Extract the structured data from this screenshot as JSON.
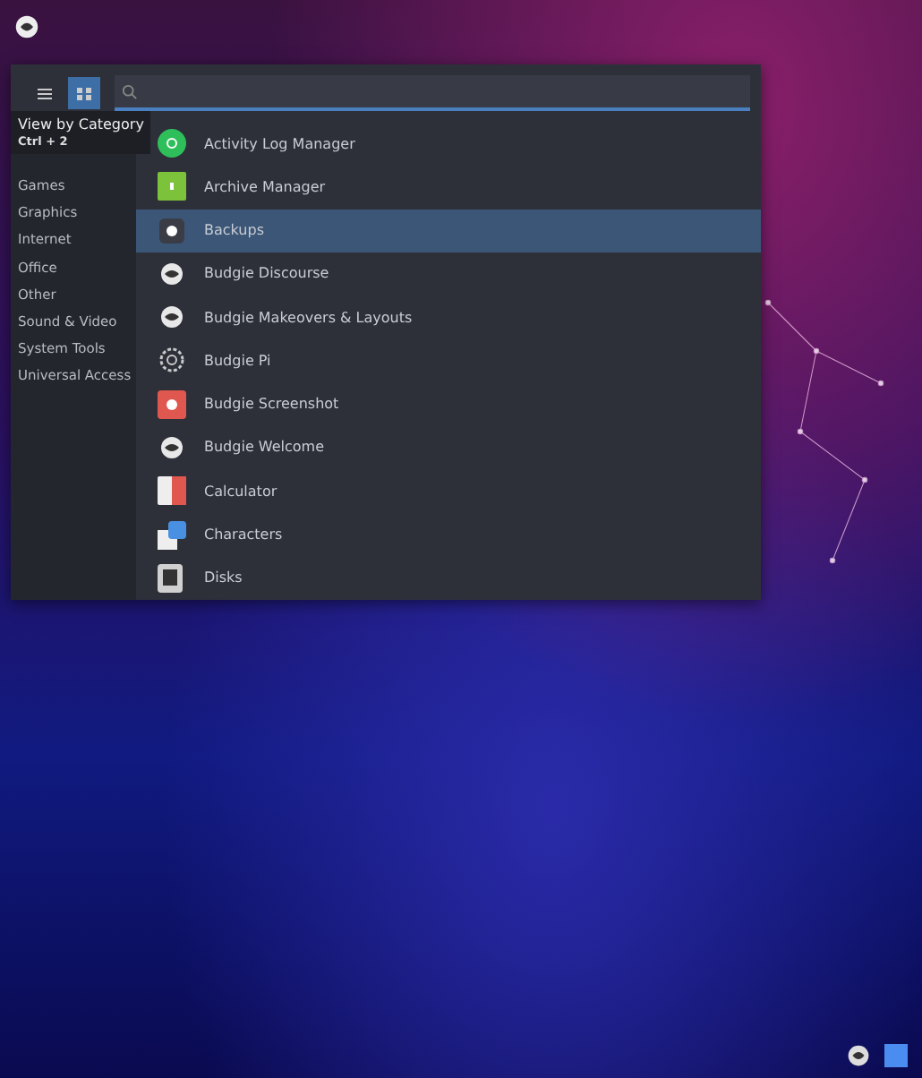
{
  "menu": {
    "view_buttons": [
      {
        "kind": "list",
        "selected": false
      },
      {
        "kind": "category",
        "selected": true
      }
    ],
    "tooltip": {
      "title": "View by Category",
      "shortcut": "Ctrl + 2"
    },
    "categories": [
      {
        "label": "Games"
      },
      {
        "label": "Graphics"
      },
      {
        "label": "Internet"
      },
      {
        "label": "Office"
      },
      {
        "label": "Other"
      },
      {
        "label": "Sound & Video"
      },
      {
        "label": "System Tools"
      },
      {
        "label": "Universal Access"
      }
    ],
    "apps": [
      {
        "label": "Activity Log Manager",
        "kind": "circle",
        "color": "#2fbf5a",
        "selected": false
      },
      {
        "label": "Archive Manager",
        "kind": "square",
        "color": "#7cc23a",
        "selected": false
      },
      {
        "label": "Backups",
        "kind": "dot",
        "color": "#3a3d46",
        "selected": true
      },
      {
        "label": "Budgie Discourse",
        "kind": "budgie",
        "color": "#e8e8e8",
        "selected": false
      },
      {
        "label": "Budgie Makeovers & Layouts",
        "kind": "budgie",
        "color": "#e8e8e8",
        "selected": false
      },
      {
        "label": "Budgie Pi",
        "kind": "gear",
        "color": "#c8c8c8",
        "selected": false
      },
      {
        "label": "Budgie Screenshot",
        "kind": "camera",
        "color": "#e0574f",
        "selected": false
      },
      {
        "label": "Budgie Welcome",
        "kind": "budgie",
        "color": "#e8e8e8",
        "selected": false
      },
      {
        "label": "Calculator",
        "kind": "calc",
        "color": "#e0574f",
        "selected": false
      },
      {
        "label": "Characters",
        "kind": "chars",
        "color": "#4a90e2",
        "selected": false
      },
      {
        "label": "Disks",
        "kind": "disk",
        "color": "#d0d0d0",
        "selected": false
      }
    ]
  }
}
